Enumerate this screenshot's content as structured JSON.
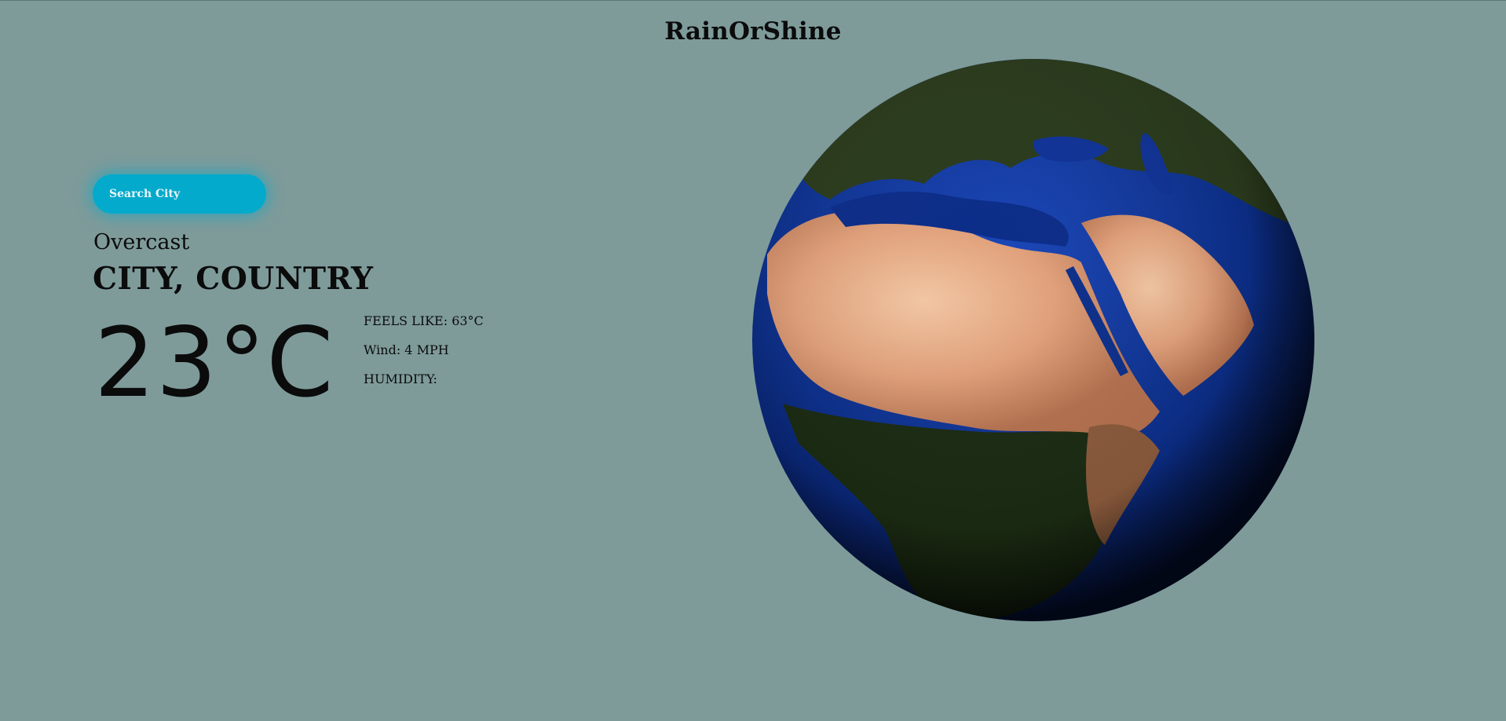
{
  "app": {
    "title": "RainOrShine"
  },
  "search": {
    "placeholder": "Search City"
  },
  "weather": {
    "condition": "Overcast",
    "location": "CITY, COUNTRY",
    "temperature": "23°C",
    "feels_like": "FEELS LIKE: 63°C",
    "wind": "Wind: 4 MPH",
    "humidity": "HUMIDITY:"
  },
  "colors": {
    "background": "#7e9b9a",
    "search_button": "#04aacb",
    "ocean": "#0c2f8a",
    "desert": "#e0a07a",
    "forest": "#1b2b12"
  }
}
